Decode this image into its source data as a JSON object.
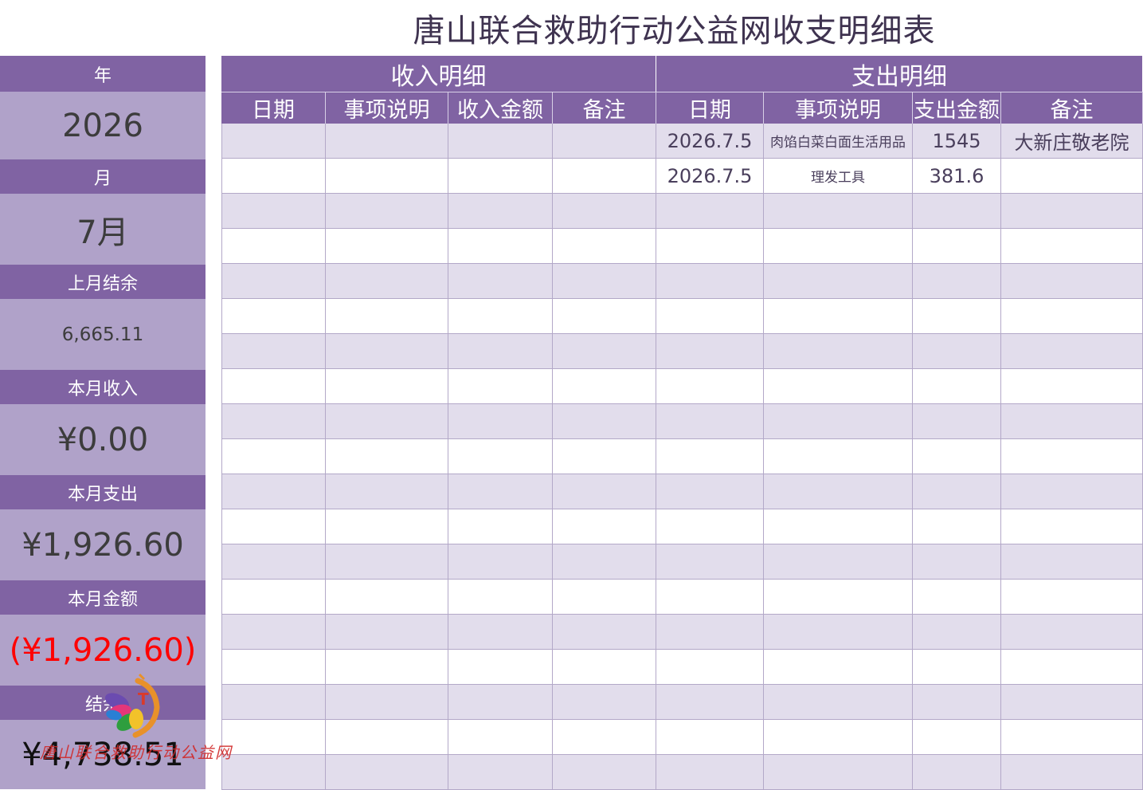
{
  "title": "唐山联合救助行动公益网收支明细表",
  "summary": {
    "year_label": "年",
    "year_value": "2026",
    "month_label": "月",
    "month_value": "7月",
    "prev_balance_label": "上月结余",
    "prev_balance_value": "6,665.11",
    "income_label": "本月收入",
    "income_value": "¥0.00",
    "expense_label": "本月支出",
    "expense_value": "¥1,926.60",
    "amount_label": "本月金额",
    "amount_value": "(¥1,926.60)",
    "balance_label": "结余",
    "balance_value": "¥4,738.51"
  },
  "income": {
    "header": "收入明细",
    "columns": [
      "日期",
      "事项说明",
      "收入金额",
      "备注"
    ]
  },
  "expense": {
    "header": "支出明细",
    "columns": [
      "日期",
      "事项说明",
      "支出金额",
      "备注"
    ],
    "rows": [
      {
        "date": "2026.7.5",
        "desc": "肉馅白菜白面生活用品",
        "amount": "1545",
        "note": "大新庄敬老院"
      },
      {
        "date": "2026.7.5",
        "desc": "理发工具",
        "amount": "381.6",
        "note": ""
      }
    ]
  },
  "watermark": "唐山联合救助行动公益网",
  "colors": {
    "header_purple": "#8063a3",
    "panel_light": "#b0a2c9",
    "row_alt": "#e2ddec",
    "negative": "#ff0000"
  },
  "icons": [
    "butterfly-logo-icon"
  ]
}
